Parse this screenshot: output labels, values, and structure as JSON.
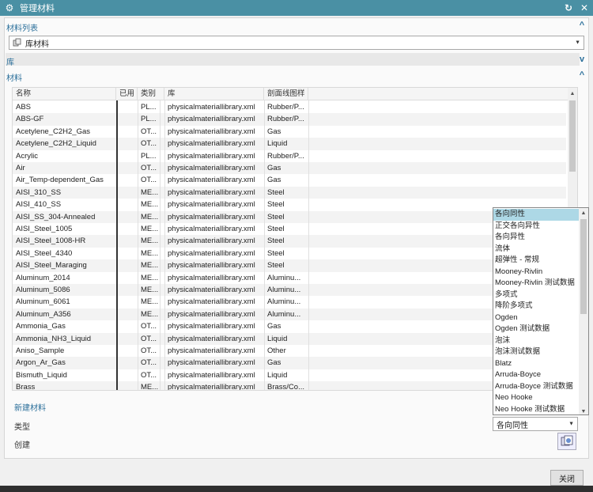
{
  "window": {
    "title": "管理材料"
  },
  "material_list": {
    "heading": "材料列表",
    "library_combo": "库材料"
  },
  "library_section": {
    "heading": "库"
  },
  "materials_section": {
    "heading": "材料",
    "columns": [
      "名称",
      "已用",
      "类别",
      "库",
      "剖面线图样"
    ],
    "rows": [
      [
        "ABS",
        "",
        "PL...",
        "physicalmateriallibrary.xml",
        "Rubber/P..."
      ],
      [
        "ABS-GF",
        "",
        "PL...",
        "physicalmateriallibrary.xml",
        "Rubber/P..."
      ],
      [
        "Acetylene_C2H2_Gas",
        "",
        "OT...",
        "physicalmateriallibrary.xml",
        "Gas"
      ],
      [
        "Acetylene_C2H2_Liquid",
        "",
        "OT...",
        "physicalmateriallibrary.xml",
        "Liquid"
      ],
      [
        "Acrylic",
        "",
        "PL...",
        "physicalmateriallibrary.xml",
        "Rubber/P..."
      ],
      [
        "Air",
        "",
        "OT...",
        "physicalmateriallibrary.xml",
        "Gas"
      ],
      [
        "Air_Temp-dependent_Gas",
        "",
        "OT...",
        "physicalmateriallibrary.xml",
        "Gas"
      ],
      [
        "AISI_310_SS",
        "",
        "ME...",
        "physicalmateriallibrary.xml",
        "Steel"
      ],
      [
        "AISI_410_SS",
        "",
        "ME...",
        "physicalmateriallibrary.xml",
        "Steel"
      ],
      [
        "AISI_SS_304-Annealed",
        "",
        "ME...",
        "physicalmateriallibrary.xml",
        "Steel"
      ],
      [
        "AISI_Steel_1005",
        "",
        "ME...",
        "physicalmateriallibrary.xml",
        "Steel"
      ],
      [
        "AISI_Steel_1008-HR",
        "",
        "ME...",
        "physicalmateriallibrary.xml",
        "Steel"
      ],
      [
        "AISI_Steel_4340",
        "",
        "ME...",
        "physicalmateriallibrary.xml",
        "Steel"
      ],
      [
        "AISI_Steel_Maraging",
        "",
        "ME...",
        "physicalmateriallibrary.xml",
        "Steel"
      ],
      [
        "Aluminum_2014",
        "",
        "ME...",
        "physicalmateriallibrary.xml",
        "Aluminu..."
      ],
      [
        "Aluminum_5086",
        "",
        "ME...",
        "physicalmateriallibrary.xml",
        "Aluminu..."
      ],
      [
        "Aluminum_6061",
        "",
        "ME...",
        "physicalmateriallibrary.xml",
        "Aluminu..."
      ],
      [
        "Aluminum_A356",
        "",
        "ME...",
        "physicalmateriallibrary.xml",
        "Aluminu..."
      ],
      [
        "Ammonia_Gas",
        "",
        "OT...",
        "physicalmateriallibrary.xml",
        "Gas"
      ],
      [
        "Ammonia_NH3_Liquid",
        "",
        "OT...",
        "physicalmateriallibrary.xml",
        "Liquid"
      ],
      [
        "Aniso_Sample",
        "",
        "OT...",
        "physicalmateriallibrary.xml",
        "Other"
      ],
      [
        "Argon_Ar_Gas",
        "",
        "OT...",
        "physicalmateriallibrary.xml",
        "Gas"
      ],
      [
        "Bismuth_Liquid",
        "",
        "OT...",
        "physicalmateriallibrary.xml",
        "Liquid"
      ],
      [
        "Brass",
        "",
        "ME...",
        "physicalmateriallibrary.xml",
        "Brass/Co..."
      ]
    ]
  },
  "new_material": {
    "heading": "新建材料",
    "type_label": "类型",
    "create_label": "创建",
    "type_value": "各向同性",
    "type_options": [
      "各向同性",
      "正交各向异性",
      "各向异性",
      "流体",
      "超弹性 - 常规",
      "Mooney-Rivlin",
      "Mooney-Rivlin 测试数据",
      "多项式",
      "降阶多项式",
      "Ogden",
      "Ogden 测试数据",
      "泡沫",
      "泡沫测试数据",
      "Blatz",
      "Arruda-Boyce",
      "Arruda-Boyce 测试数据",
      "Neo Hooke",
      "Neo Hooke 测试数据"
    ]
  },
  "footer": {
    "close_label": "关闭"
  },
  "colors": {
    "titlebar": "#4a90a4",
    "accent": "#2b6f9a",
    "selection": "#add8e6"
  }
}
